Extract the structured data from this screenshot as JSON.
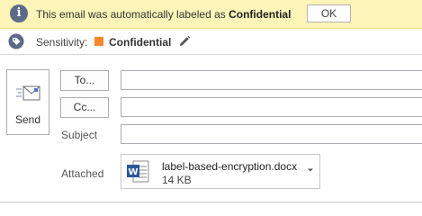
{
  "infobar": {
    "message_prefix": "This email was automatically labeled as",
    "message_label": "Confidential",
    "ok_label": "OK",
    "color": "#fdf4b8"
  },
  "sensitivity": {
    "label": "Sensitivity:",
    "value": "Confidential",
    "swatch_color": "#f3892a",
    "icons": [
      "tag-icon",
      "pencil-icon"
    ]
  },
  "compose": {
    "send_label": "Send",
    "to_label": "To...",
    "cc_label": "Cc...",
    "to_value": "",
    "cc_value": "",
    "subject_label": "Subject",
    "subject_value": "",
    "attached_label": "Attached"
  },
  "attachment": {
    "name": "label-based-encryption.docx",
    "size": "14 KB",
    "icon": "word-icon"
  }
}
